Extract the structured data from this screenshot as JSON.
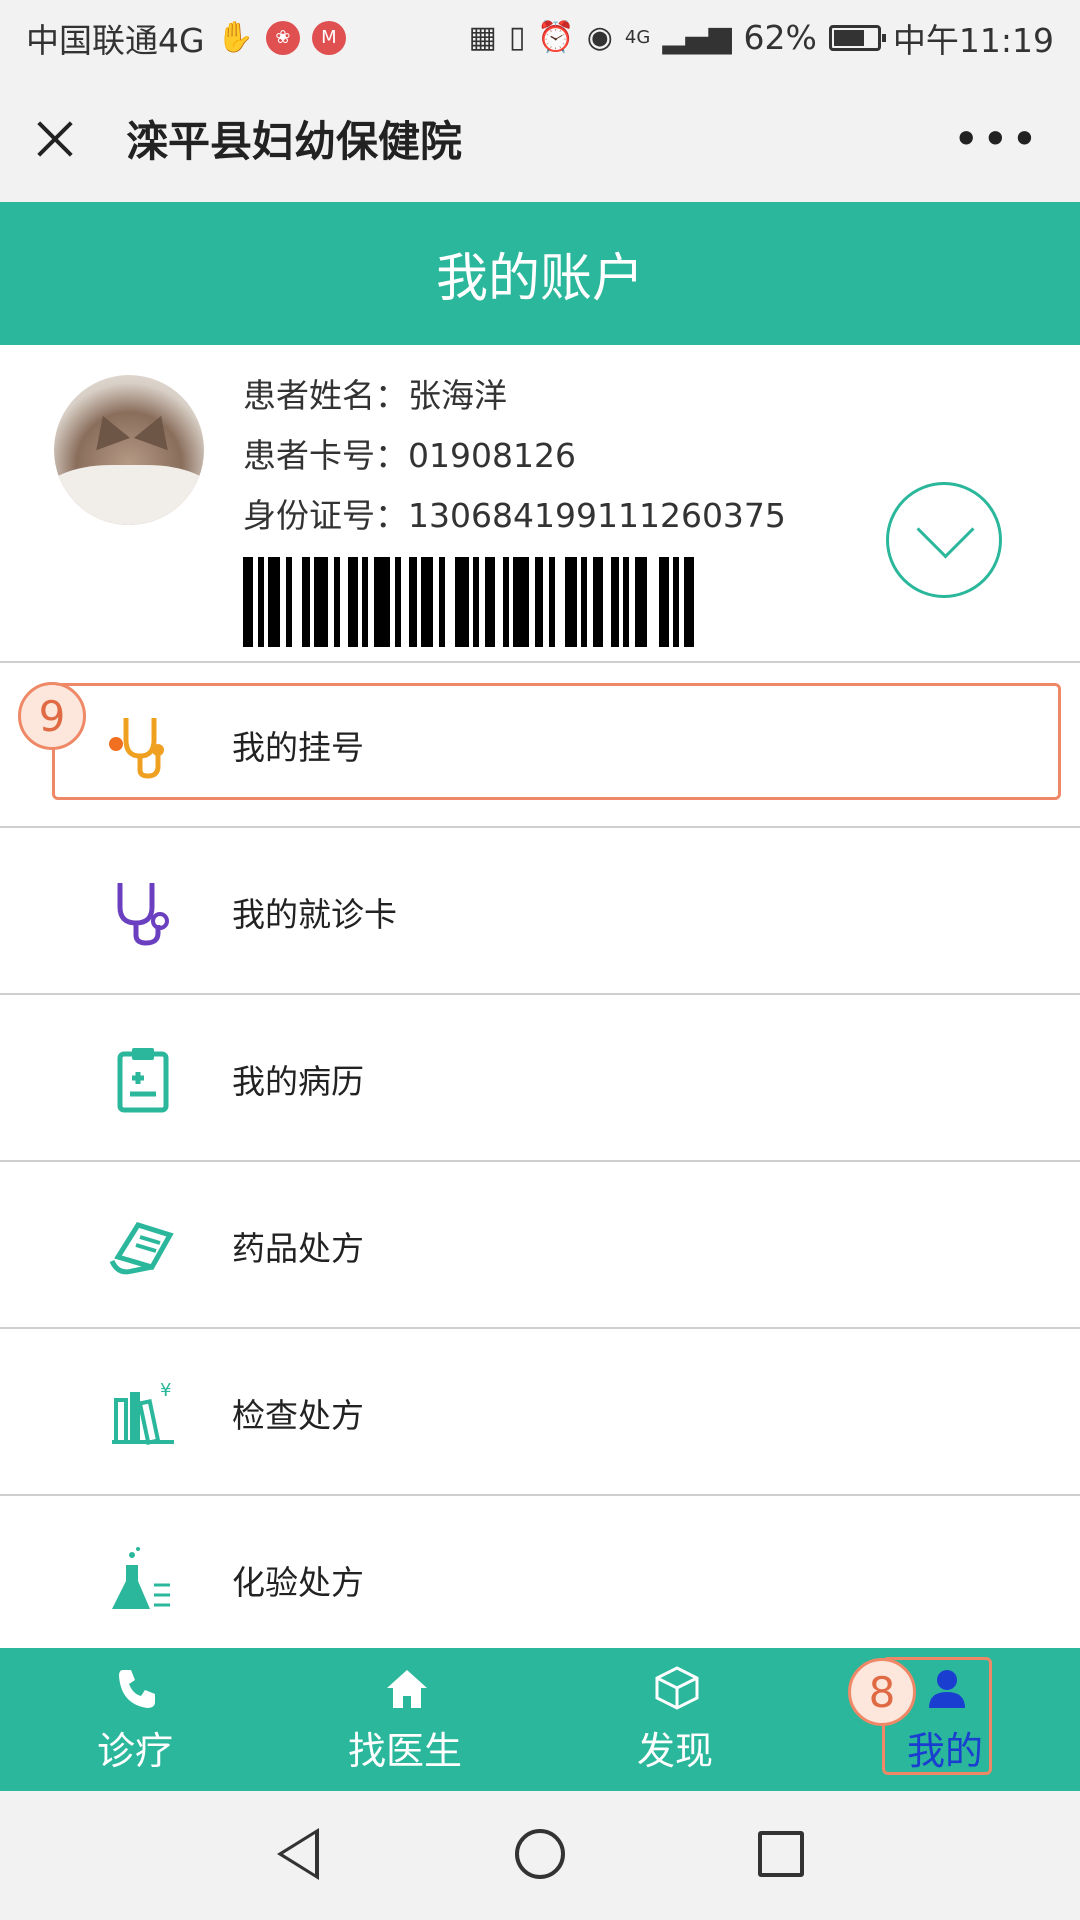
{
  "status_bar": {
    "carrier": "中国联通4G",
    "battery": "62%",
    "time": "中午11:19",
    "signal_label": "4G"
  },
  "title_bar": {
    "title": "滦平县妇幼保健院"
  },
  "header": {
    "title": "我的账户"
  },
  "profile": {
    "name_label": "患者姓名：",
    "name_value": "张海洋",
    "card_label": "患者卡号：",
    "card_value": "01908126",
    "id_label": "身份证号：",
    "id_value": "130684199111260375"
  },
  "menu": {
    "items": [
      {
        "label": "我的挂号",
        "icon": "stethoscope-orange-icon"
      },
      {
        "label": "我的就诊卡",
        "icon": "stethoscope-purple-icon"
      },
      {
        "label": "我的病历",
        "icon": "clipboard-icon"
      },
      {
        "label": "药品处方",
        "icon": "prescription-scroll-icon"
      },
      {
        "label": "检查处方",
        "icon": "books-yen-icon"
      },
      {
        "label": "化验处方",
        "icon": "flask-icon"
      }
    ]
  },
  "annotations": {
    "menu_badge": "9",
    "nav_badge": "8"
  },
  "bottom_nav": {
    "items": [
      {
        "label": "诊疗",
        "icon": "phone-icon"
      },
      {
        "label": "找医生",
        "icon": "home-icon"
      },
      {
        "label": "发现",
        "icon": "cube-icon"
      },
      {
        "label": "我的",
        "icon": "person-icon"
      }
    ],
    "active_index": 3
  },
  "colors": {
    "accent": "#2bb79b",
    "highlight": "#ee8866",
    "active_label": "#1a3fd0"
  }
}
